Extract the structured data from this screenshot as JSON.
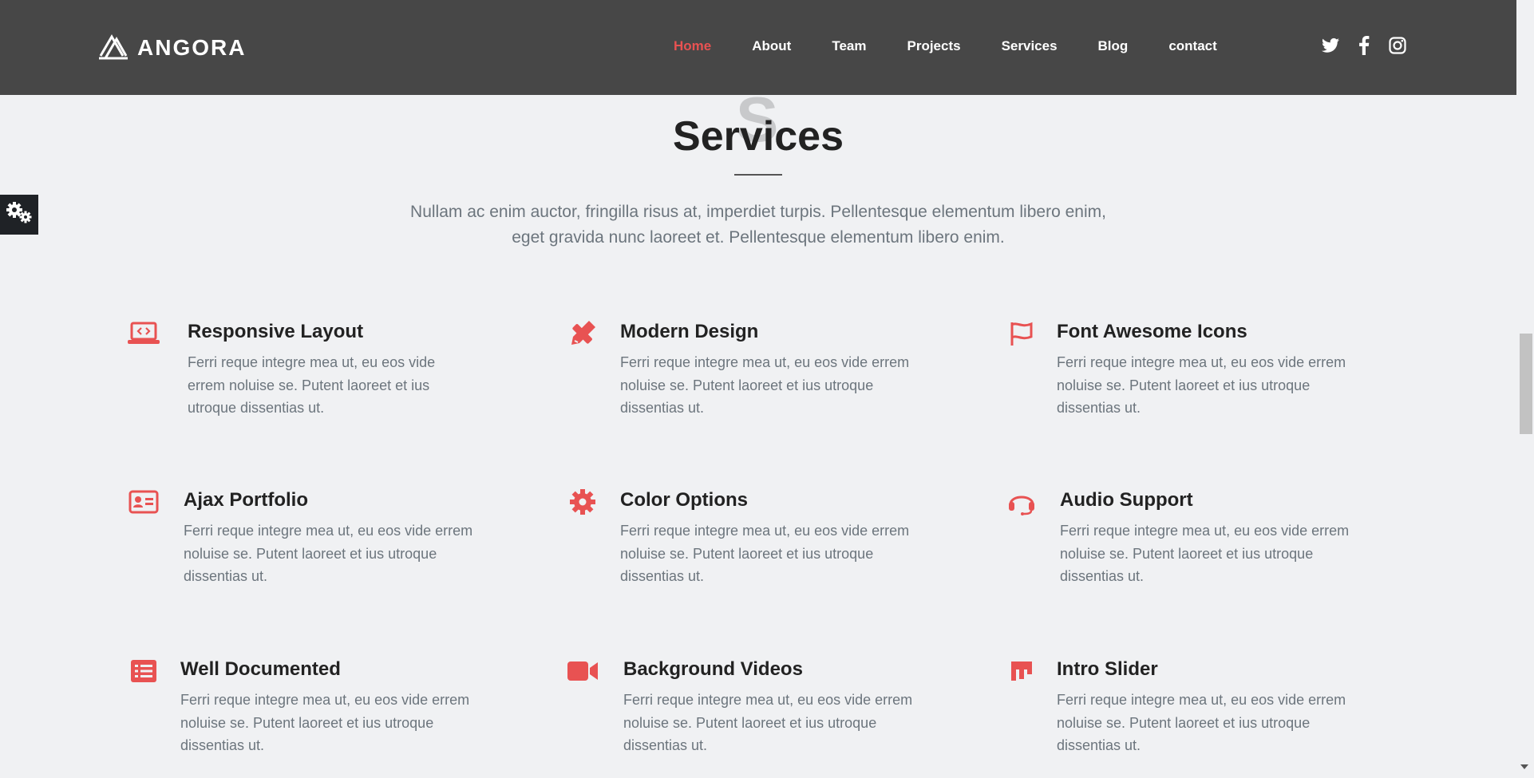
{
  "header": {
    "brand": "ANGORA",
    "nav": [
      {
        "label": "Home",
        "active": true
      },
      {
        "label": "About"
      },
      {
        "label": "Team"
      },
      {
        "label": "Projects"
      },
      {
        "label": "Services"
      },
      {
        "label": "Blog"
      },
      {
        "label": "contact"
      }
    ],
    "social_icons": [
      "twitter-icon",
      "facebook-icon",
      "instagram-icon"
    ]
  },
  "colors": {
    "accent": "#e85252",
    "header_bg": "#474747",
    "page_bg": "#f0f1f3",
    "title": "#222222",
    "text": "#6c757d"
  },
  "section": {
    "bg_letter": "S",
    "title": "Services",
    "description": "Nullam ac enim auctor, fringilla risus at, imperdiet turpis. Pellentesque elementum libero enim, eget gravida nunc laoreet et. Pellentesque elementum libero enim."
  },
  "features": [
    {
      "icon": "laptop-code-icon",
      "title": "Responsive Layout",
      "text": "Ferri reque integre mea ut, eu eos vide errem noluise se. Putent laoreet et ius utroque dissentias ut."
    },
    {
      "icon": "pencil-ruler-icon",
      "title": "Modern Design",
      "text": "Ferri reque integre mea ut, eu eos vide errem noluise se. Putent laoreet et ius utroque dissentias ut."
    },
    {
      "icon": "flag-icon",
      "title": "Font Awesome Icons",
      "text": "Ferri reque integre mea ut, eu eos vide errem noluise se. Putent laoreet et ius utroque dissentias ut."
    },
    {
      "icon": "id-card-icon",
      "title": "Ajax Portfolio",
      "text": "Ferri reque integre mea ut, eu eos vide errem noluise se. Putent laoreet et ius utroque dissentias ut."
    },
    {
      "icon": "cog-icon",
      "title": "Color Options",
      "text": "Ferri reque integre mea ut, eu eos vide errem noluise se. Putent laoreet et ius utroque dissentias ut."
    },
    {
      "icon": "headset-icon",
      "title": "Audio Support",
      "text": "Ferri reque integre mea ut, eu eos vide errem noluise se. Putent laoreet et ius utroque dissentias ut."
    },
    {
      "icon": "list-alt-icon",
      "title": "Well Documented",
      "text": "Ferri reque integre mea ut, eu eos vide errem noluise se. Putent laoreet et ius utroque dissentias ut."
    },
    {
      "icon": "video-icon",
      "title": "Background Videos",
      "text": "Ferri reque integre mea ut, eu eos vide errem noluise se. Putent laoreet et ius utroque dissentias ut."
    },
    {
      "icon": "slider-icon",
      "title": "Intro Slider",
      "text": "Ferri reque integre mea ut, eu eos vide errem noluise se. Putent laoreet et ius utroque dissentias ut."
    }
  ]
}
